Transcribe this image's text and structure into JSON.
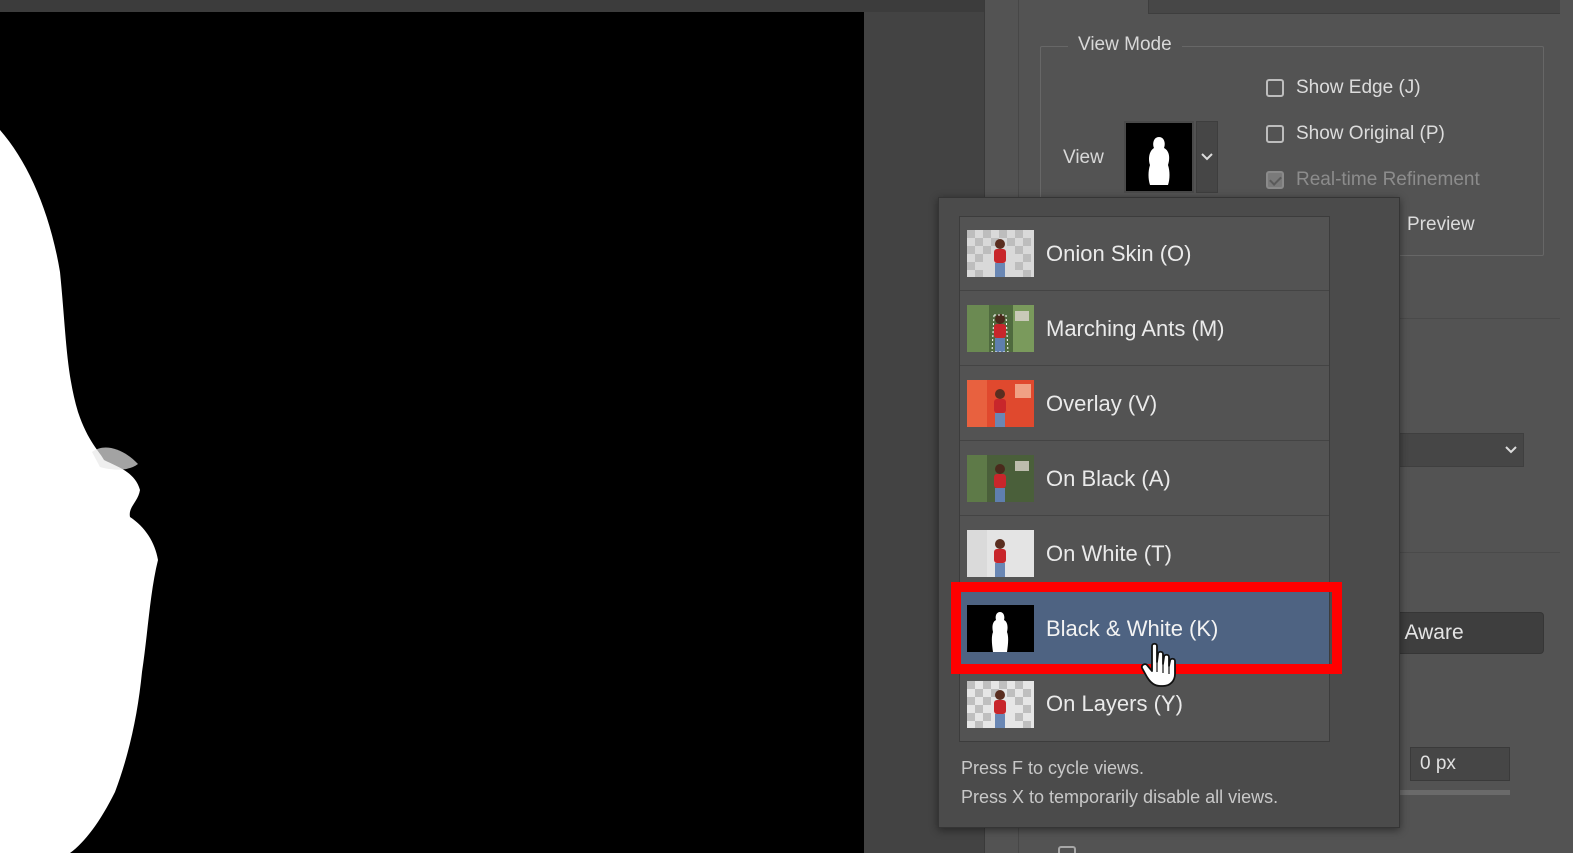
{
  "view_mode": {
    "legend": "View Mode",
    "view_label": "View",
    "show_edge": {
      "label": "Show Edge (J)",
      "checked": false
    },
    "show_original": {
      "label": "Show Original (P)",
      "checked": false
    },
    "realtime_refinement": {
      "label": "Real-time Refinement",
      "checked": true,
      "disabled": true
    },
    "preview_label": "Preview"
  },
  "panel": {
    "aware_button_label": "t Aware",
    "radius_value": "0 px"
  },
  "view_menu": {
    "items": [
      {
        "label": "Onion Skin (O)",
        "thumb": "onion-skin-thumbnail"
      },
      {
        "label": "Marching Ants (M)",
        "thumb": "marching-ants-thumbnail"
      },
      {
        "label": "Overlay (V)",
        "thumb": "overlay-thumbnail"
      },
      {
        "label": "On Black (A)",
        "thumb": "on-black-thumbnail"
      },
      {
        "label": "On White (T)",
        "thumb": "on-white-thumbnail"
      },
      {
        "label": "Black & White (K)",
        "thumb": "black-white-thumbnail",
        "selected": true
      },
      {
        "label": "On Layers (Y)",
        "thumb": "on-layers-thumbnail"
      }
    ],
    "hint_1": "Press F to cycle views.",
    "hint_2": "Press X to temporarily disable all views."
  },
  "colors": {
    "selected_item_bg": "#4e6382",
    "highlight_outline": "#ff0000",
    "panel_bg": "#535353"
  },
  "icons": {
    "cursor": "pointing-hand-cursor-icon",
    "dropdown": "chevron-down-icon"
  }
}
